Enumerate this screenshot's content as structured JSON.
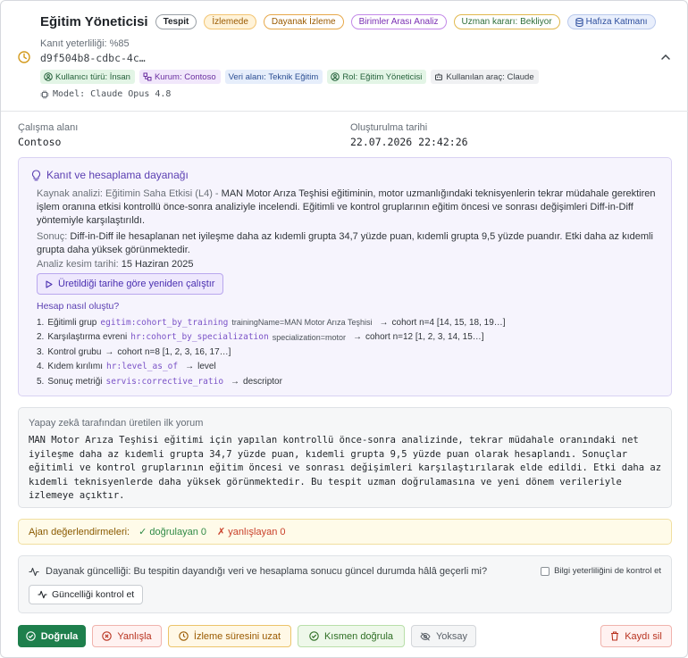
{
  "header": {
    "title": "Eğitim Yöneticisi",
    "pills": {
      "tespit": "Tespit",
      "izleme": "İzlemede",
      "dayanak": "Dayanak İzleme",
      "birimler": "Birimler Arası Analiz",
      "uzman": "Uzman kararı: Bekliyor",
      "hafiza": "Hafıza Katmanı"
    },
    "confidence": "Kanıt yeterliliği: %85",
    "hash": "d9f504b8-cdbc-4c…",
    "tags": {
      "user_type": "Kullanıcı türü: İnsan",
      "org": "Kurum: Contoso",
      "data_area": "Veri alanı: Teknik Eğitim",
      "role": "Rol: Eğitim Yöneticisi",
      "tool": "Kullanılan araç: Claude"
    },
    "model": "Model: Claude Opus 4.8"
  },
  "meta": {
    "workspace_label": "Çalışma alanı",
    "workspace_value": "Contoso",
    "created_label": "Oluşturulma tarihi",
    "created_value": "22.07.2026 22:42:26"
  },
  "evidence": {
    "heading": "Kanıt ve hesaplama dayanağı",
    "source_label": "Kaynak analizi: Eğitimin Saha Etkisi (L4) -",
    "source_text": "MAN Motor Arıza Teşhisi eğitiminin, motor uzmanlığındaki teknisyenlerin tekrar müdahale gerektiren işlem oranına etkisi kontrollü önce-sonra analiziyle incelendi. Eğitimli ve kontrol gruplarının eğitim öncesi ve sonrası değişimleri Diff-in-Diff yöntemiyle karşılaştırıldı.",
    "result_label": "Sonuç:",
    "result_text": "Diff-in-Diff ile hesaplanan net iyileşme daha az kıdemli grupta 34,7 yüzde puan, kıdemli grupta 9,5 yüzde puandır. Etki daha az kıdemli grupta daha yüksek görünmektedir.",
    "cutoff_label": "Analiz kesim tarihi:",
    "cutoff_value": "15 Haziran 2025",
    "rerun_button": "Üretildiği tarihe göre yeniden çalıştır",
    "how_title": "Hesap nasıl oluştu?",
    "steps": [
      {
        "num": "1.",
        "label": "Eğitimli grup",
        "code": "egitim:cohort_by_training",
        "param": "trainingName=MAN Motor Arıza Teşhisi",
        "arrow": "→",
        "result": "cohort n=4 [14, 15, 18, 19…]"
      },
      {
        "num": "2.",
        "label": "Karşılaştırma evreni",
        "code": "hr:cohort_by_specialization",
        "param": "specialization=motor",
        "arrow": "→",
        "result": "cohort n=12 [1, 2, 3, 14, 15…]"
      },
      {
        "num": "3.",
        "label": "Kontrol grubu",
        "code": "",
        "param": "",
        "arrow": "→",
        "result": "cohort n=8 [1, 2, 3, 16, 17…]"
      },
      {
        "num": "4.",
        "label": "Kıdem kırılımı",
        "code": "hr:level_as_of",
        "param": "",
        "arrow": "→",
        "result": "level"
      },
      {
        "num": "5.",
        "label": "Sonuç metriği",
        "code": "servis:corrective_ratio",
        "param": "",
        "arrow": "→",
        "result": "descriptor"
      }
    ]
  },
  "ai": {
    "label": "Yapay zekâ tarafından üretilen ilk yorum",
    "text": "MAN Motor Arıza Teşhisi eğitimi için yapılan kontrollü önce-sonra analizinde, tekrar müdahale oranındaki net iyileşme daha az kıdemli grupta 34,7 yüzde puan, kıdemli grupta 9,5 yüzde puan olarak hesaplandı. Sonuçlar eğitimli ve kontrol gruplarının eğitim öncesi ve sonrası değişimleri karşılaştırılarak elde edildi. Etki daha az kıdemli teknisyenlerde daha yüksek görünmektedir. Bu tespit uzman doğrulamasına ve yeni dönem verileriyle izlemeye açıktır."
  },
  "reviews": {
    "label": "Ajan değerlendirmeleri:",
    "confirmed": "✓ doğrulayan 0",
    "rejected": "✗ yanlışlayan 0"
  },
  "currency": {
    "question": "Dayanak güncelliği: Bu tespitin dayandığı veri ve hesaplama sonucu güncel durumda hâlâ geçerli mi?",
    "checkbox_label": "Bilgi yeterliliğini de kontrol et",
    "check_button": "Güncelliği kontrol et"
  },
  "actions": {
    "confirm": "Doğrula",
    "reject": "Yanlışla",
    "extend": "İzleme süresini uzat",
    "partial": "Kısmen doğrula",
    "ignore": "Yoksay",
    "delete": "Kaydı sil"
  },
  "colors": {
    "accent_purple": "#5b3fb2",
    "confirm_green": "#1e7f4c",
    "danger_red": "#b8321f",
    "warning_amber": "#9a5a00"
  }
}
